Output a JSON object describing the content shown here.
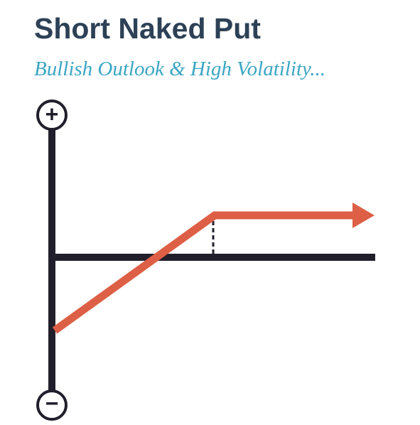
{
  "header": {
    "title": "Short Naked Put",
    "subtitle": "Bullish Outlook & High Volatility..."
  },
  "diagram": {
    "profit_symbol": "+",
    "loss_symbol": "−",
    "strategy": "short naked put",
    "payoff_shape": "rises with price until the strike, then flat at max profit with arrow extending right",
    "strike_marker": "dashed vertical line from payoff kink down to zero line",
    "icons": {
      "profit": "plus-circle-icon",
      "loss": "minus-circle-icon",
      "continuation": "arrow-right-icon"
    }
  },
  "colors": {
    "title": "#2d4156",
    "subtitle": "#3aa6c4",
    "axis": "#221f2c",
    "payoff": "#dd5f45",
    "background": "#ffffff"
  }
}
